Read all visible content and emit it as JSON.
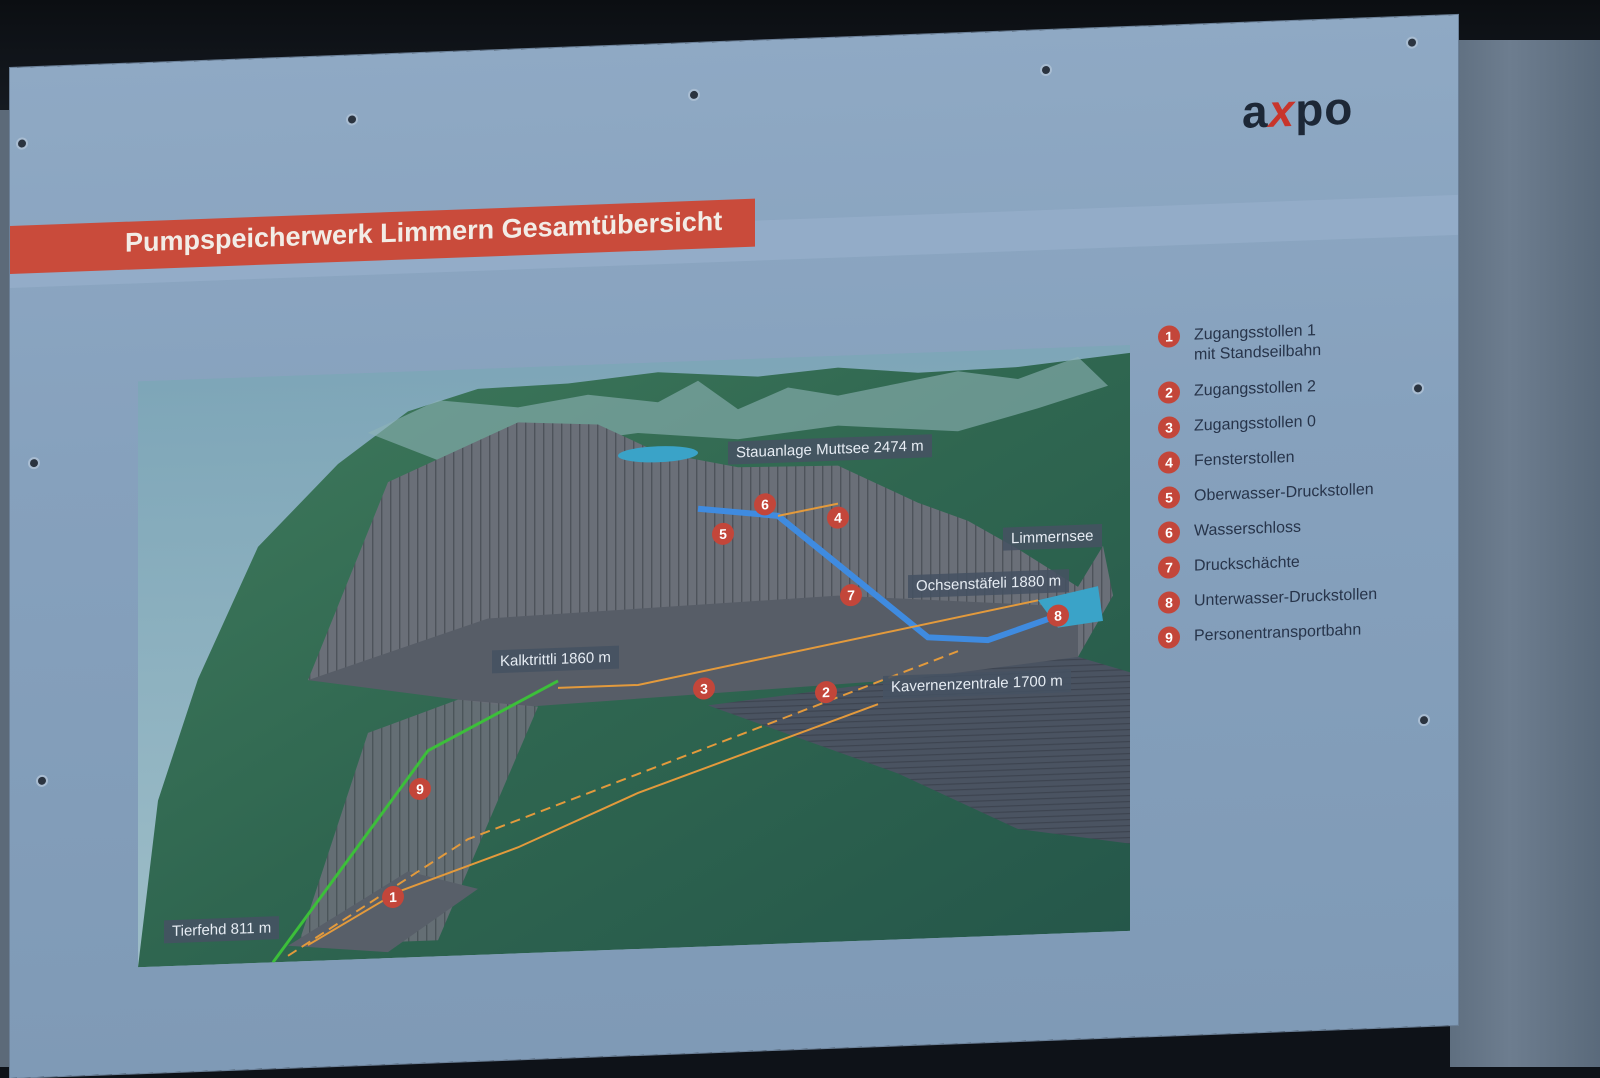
{
  "title": "Pumpspeicherwerk Limmern Gesamtübersicht",
  "logo": {
    "prefix": "a",
    "bolt": "x",
    "suffix": "po"
  },
  "legend": [
    {
      "num": "1",
      "label": "Zugangsstollen 1",
      "sub": "mit Standseilbahn"
    },
    {
      "num": "2",
      "label": "Zugangsstollen 2"
    },
    {
      "num": "3",
      "label": "Zugangsstollen 0"
    },
    {
      "num": "4",
      "label": "Fensterstollen"
    },
    {
      "num": "5",
      "label": "Oberwasser-Druckstollen"
    },
    {
      "num": "6",
      "label": "Wasserschloss"
    },
    {
      "num": "7",
      "label": "Druckschächte"
    },
    {
      "num": "8",
      "label": "Unterwasser-Druckstollen"
    },
    {
      "num": "9",
      "label": "Personentransportbahn"
    }
  ],
  "places": {
    "muttsee": "Stauanlage Muttsee 2474 m",
    "limmernsee": "Limmernsee",
    "ochsenstafeli": "Ochsenstäfeli 1880 m",
    "kalktrittli": "Kalktrittli 1860 m",
    "kavernenzentrale": "Kavernenzentrale 1700 m",
    "tierfehd": "Tierfehd 811 m"
  },
  "markers": [
    "1",
    "2",
    "3",
    "4",
    "5",
    "6",
    "7",
    "8",
    "9"
  ],
  "colors": {
    "accent_red": "#c94b3b",
    "pipe_blue": "#3f8be0",
    "tunnel_orange": "#e39a3c",
    "rail_green": "#3cbf3a"
  }
}
